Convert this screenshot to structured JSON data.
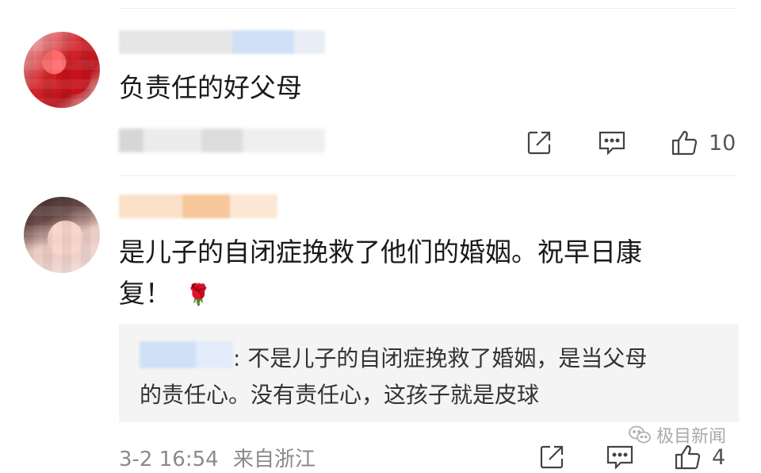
{
  "comment1": {
    "text": "负责任的好父母",
    "like_count": "10",
    "icons": [
      "share-icon",
      "comment-icon",
      "like-icon"
    ]
  },
  "comment2": {
    "text_line1": "是儿子的自闭症挽救了他们的婚姻。祝早日康",
    "text_line2": "复！",
    "emoji": "🌹",
    "reply": {
      "line1": ": 不是儿子的自闭症挽救了婚姻，是当父母",
      "line2": "的责任心。没有责任心，这孩子就是皮球"
    },
    "timestamp": "3-2 16:54",
    "location": "来自浙江",
    "like_count": "4",
    "icons": [
      "share-icon",
      "comment-icon",
      "like-icon"
    ]
  },
  "watermark": {
    "text": "极目新闻",
    "icon": "wechat-icon"
  },
  "colors": {
    "background": "#ffffff",
    "text": "#1a1a1a",
    "meta": "#8a8a8a",
    "reply_bg": "#f4f4f4"
  }
}
